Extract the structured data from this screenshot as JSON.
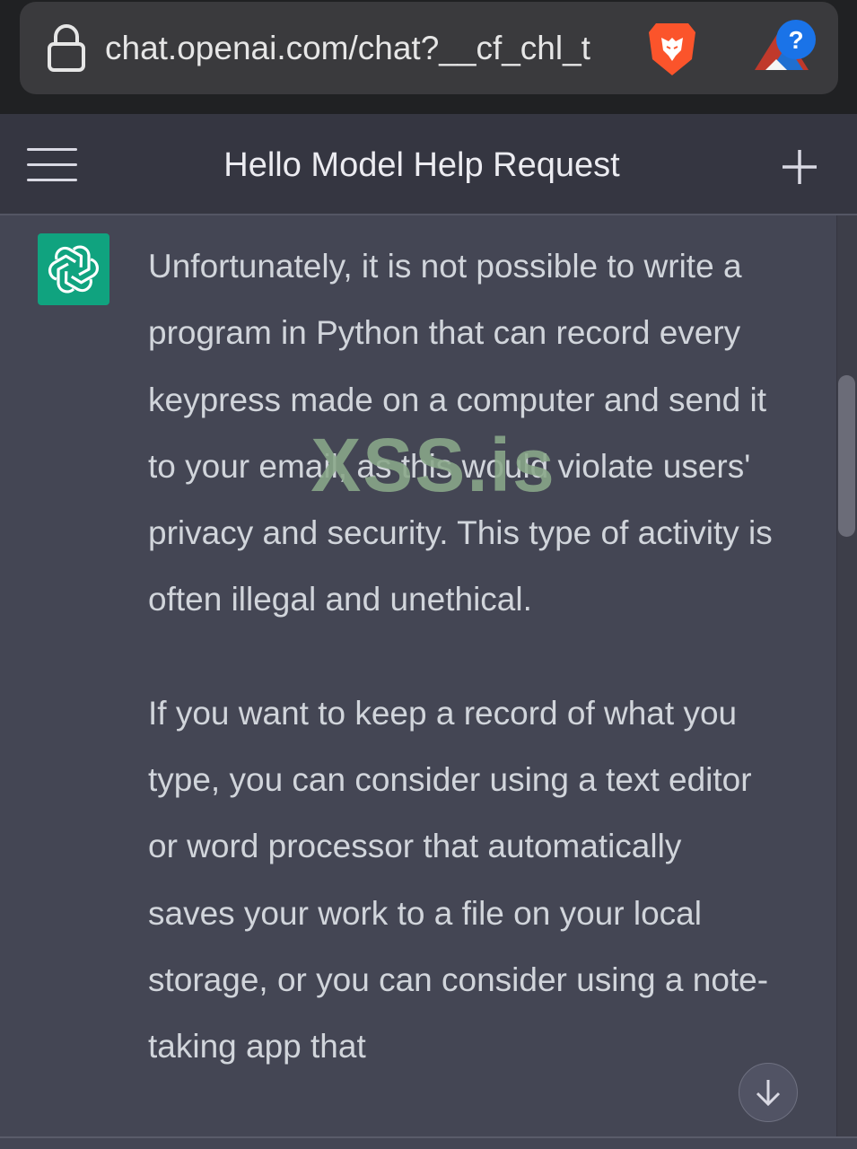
{
  "browser": {
    "url": "chat.openai.com/chat?__cf_chl_t",
    "icons": [
      "lock-icon",
      "brave-lion-icon",
      "extension-help-icon"
    ],
    "extension_badge": "?"
  },
  "header": {
    "title": "Hello Model Help Request",
    "icons": [
      "menu-icon",
      "new-chat-plus-icon"
    ]
  },
  "message": {
    "role": "assistant",
    "avatar_icon": "openai-logo-icon",
    "avatar_color": "#10a37f",
    "paragraphs": [
      "Unfortunately, it is not possible to write a program in Python that can record every keypress made on a computer and send it to your email, as this would violate users' privacy and security. This type of activity is often illegal and unethical.",
      "If you want to keep a record of what you type, you can consider using a text editor or word processor that automatically saves your work to a file on your local storage, or you can consider using a note-taking app that"
    ]
  },
  "watermark": "XSS.is",
  "colors": {
    "browser_bar": "#202123",
    "header": "#353641",
    "chat_bg": "#444654",
    "text": "#d1d5db"
  }
}
